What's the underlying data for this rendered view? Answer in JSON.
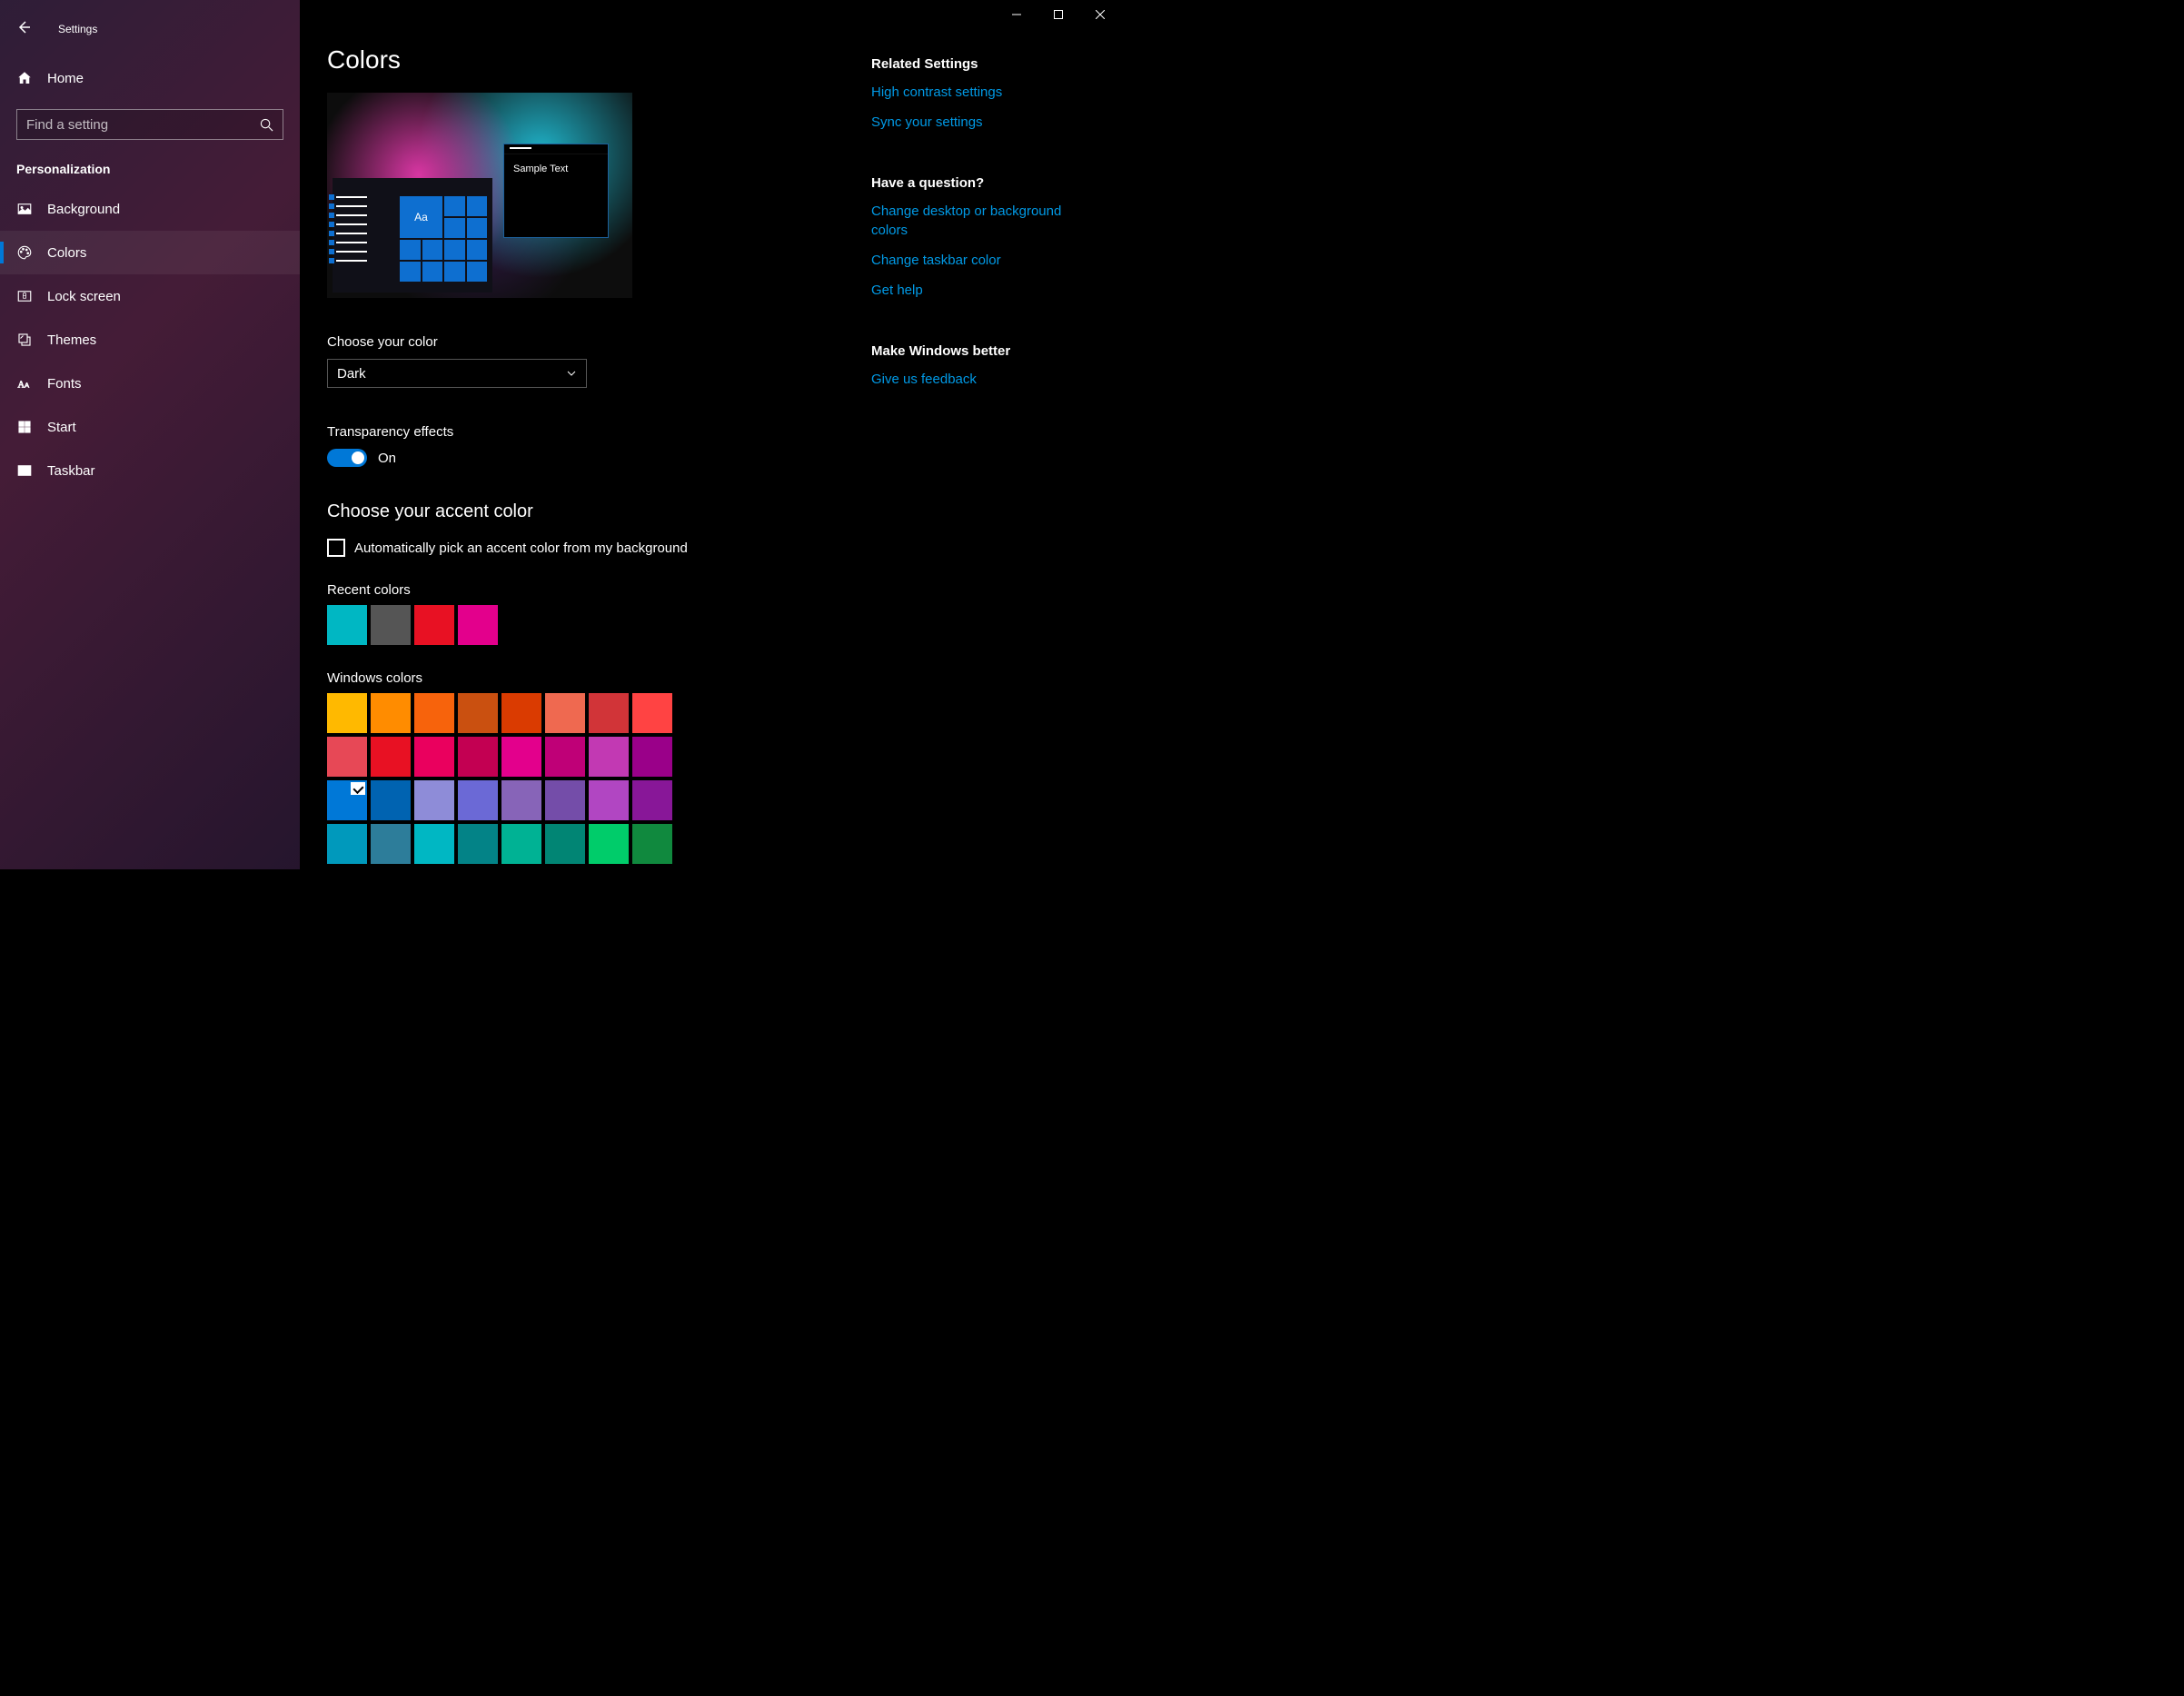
{
  "titlebar": {
    "app_title": "Settings"
  },
  "sidebar": {
    "home": "Home",
    "search_placeholder": "Find a setting",
    "section_title": "Personalization",
    "items": [
      {
        "label": "Background"
      },
      {
        "label": "Colors"
      },
      {
        "label": "Lock screen"
      },
      {
        "label": "Themes"
      },
      {
        "label": "Fonts"
      },
      {
        "label": "Start"
      },
      {
        "label": "Taskbar"
      }
    ]
  },
  "page": {
    "heading": "Colors",
    "preview_sample_text": "Sample Text",
    "preview_tile_text": "Aa",
    "choose_color_label": "Choose your color",
    "choose_color_value": "Dark",
    "transparency_label": "Transparency effects",
    "transparency_state": "On",
    "accent_heading": "Choose your accent color",
    "accent_checkbox_label": "Automatically pick an accent color from my background",
    "recent_label": "Recent colors",
    "recent_colors": [
      "#00b7c3",
      "#555555",
      "#e81123",
      "#e3008c"
    ],
    "windows_label": "Windows colors",
    "windows_colors": [
      "#ffb900",
      "#ff8c00",
      "#f7630c",
      "#ca5010",
      "#da3b01",
      "#ef6950",
      "#d13438",
      "#ff4343",
      "#e74856",
      "#e81123",
      "#ea005e",
      "#c30052",
      "#e3008c",
      "#bf0077",
      "#c239b3",
      "#9a0089",
      "#0078d7",
      "#0063b1",
      "#8e8cd8",
      "#6b69d6",
      "#8764b8",
      "#744da9",
      "#b146c2",
      "#881798",
      "#0099bc",
      "#2d7d9a",
      "#00b7c3",
      "#038387",
      "#00b294",
      "#018574",
      "#00cc6a",
      "#10893e"
    ],
    "selected_color": "#0078d7"
  },
  "right": {
    "related_title": "Related Settings",
    "related_links": [
      "High contrast settings",
      "Sync your settings"
    ],
    "question_title": "Have a question?",
    "question_links": [
      "Change desktop or background colors",
      "Change taskbar color",
      "Get help"
    ],
    "better_title": "Make Windows better",
    "better_links": [
      "Give us feedback"
    ]
  }
}
